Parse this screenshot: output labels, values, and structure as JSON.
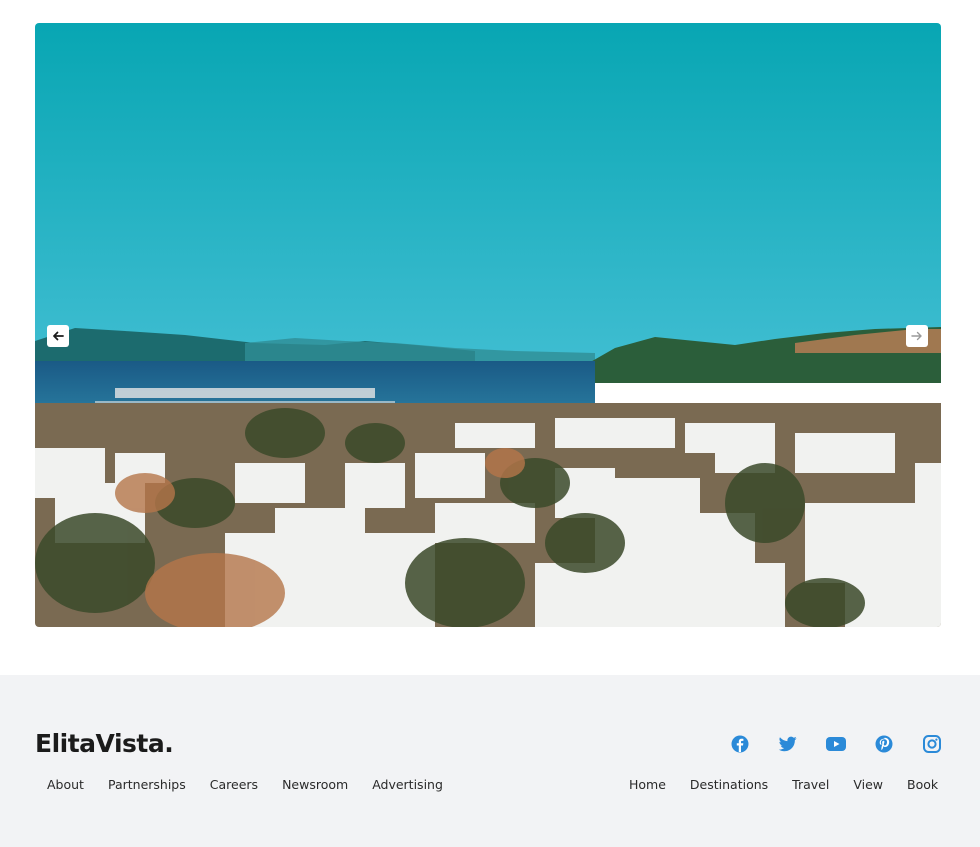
{
  "hero": {
    "image_description_icon": "landscape-photo",
    "prev_icon": "arrow-left-icon",
    "next_icon": "arrow-right-icon"
  },
  "footer": {
    "brand": "ElitaVista.",
    "social": [
      "facebook-icon",
      "twitter-icon",
      "youtube-icon",
      "pinterest-icon",
      "instagram-icon"
    ],
    "left_links": [
      "About",
      "Partnerships",
      "Careers",
      "Newsroom",
      "Advertising"
    ],
    "right_links": [
      "Home",
      "Destinations",
      "Travel",
      "View",
      "Book"
    ]
  },
  "colors": {
    "accent": "#2b8ad8",
    "footer_bg": "#f2f3f5",
    "sky": "#09a7b5"
  }
}
